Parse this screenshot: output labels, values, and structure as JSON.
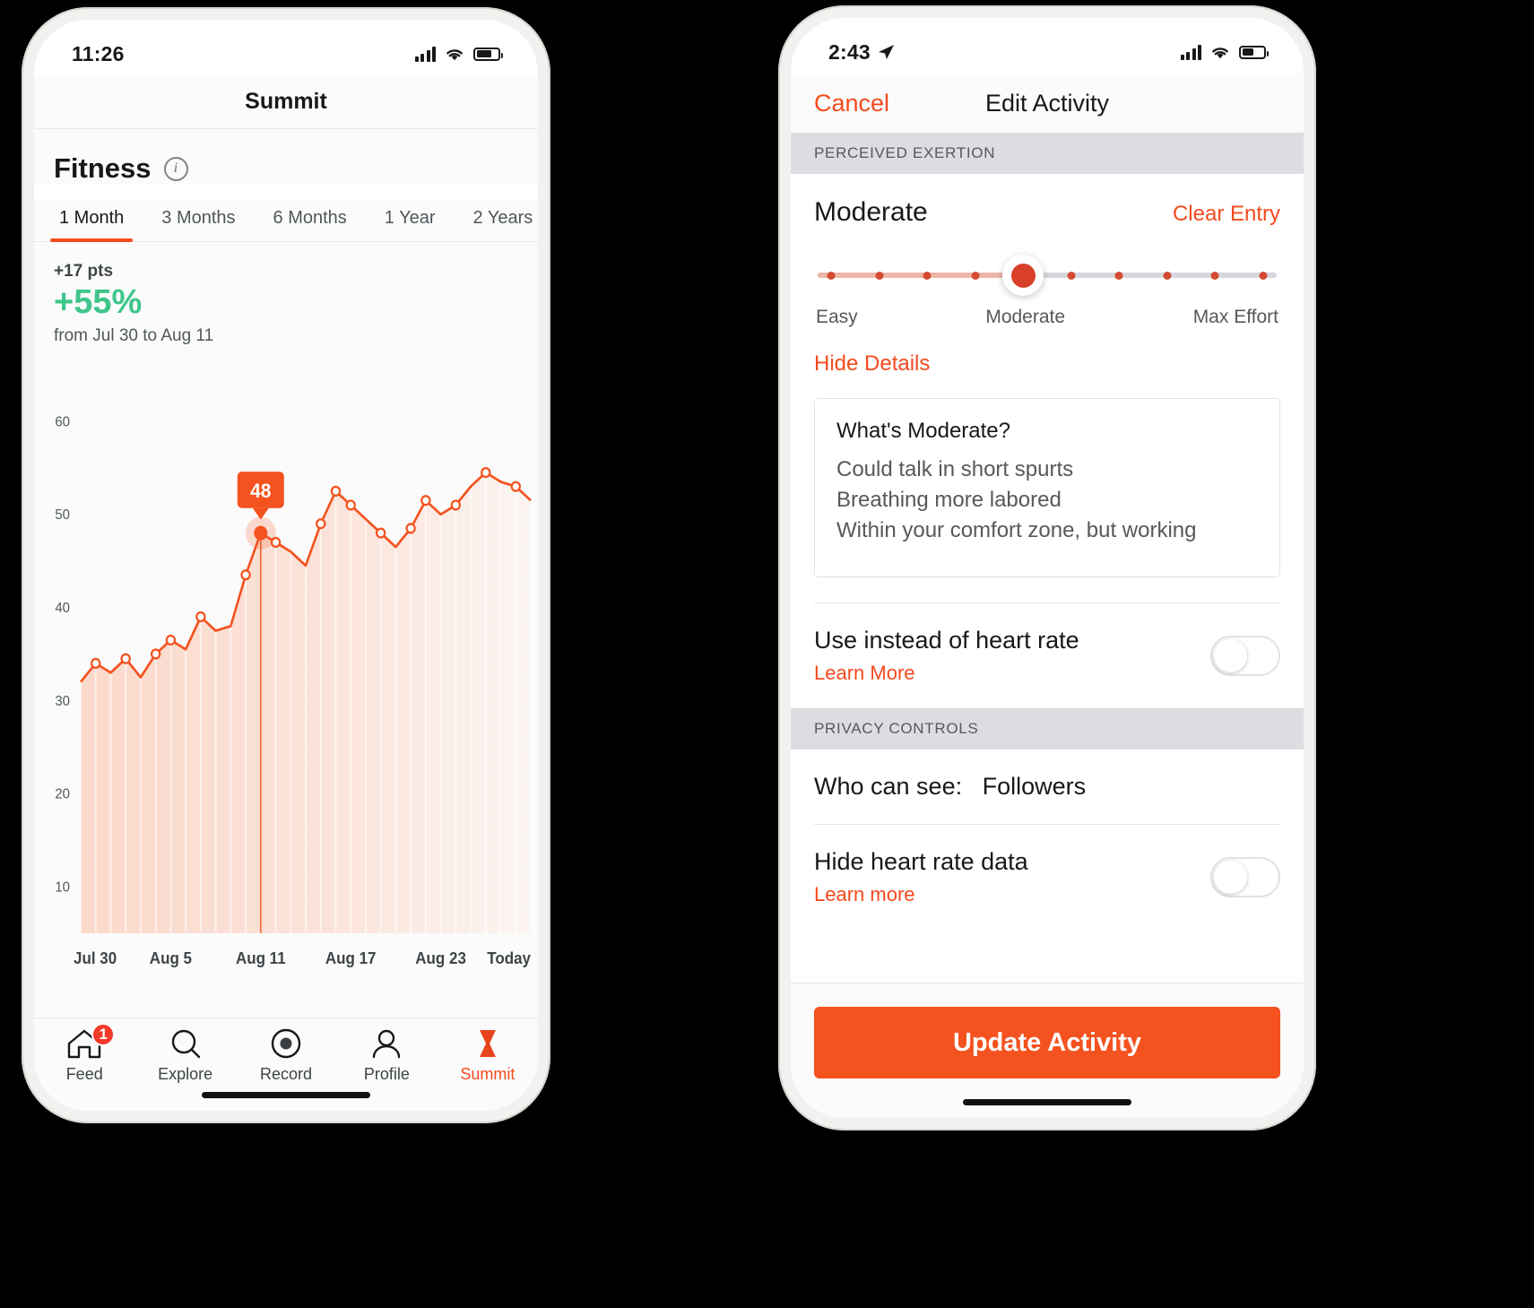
{
  "left_phone": {
    "status_bar": {
      "time": "11:26",
      "signal_icon": "cellular-bars-icon",
      "wifi_icon": "wifi-icon",
      "battery_icon": "battery-icon"
    },
    "nav_title": "Summit",
    "section_title": "Fitness",
    "info_icon": "info-icon",
    "range_tabs": [
      {
        "label": "1 Month",
        "active": true
      },
      {
        "label": "3 Months",
        "active": false
      },
      {
        "label": "6 Months",
        "active": false
      },
      {
        "label": "1 Year",
        "active": false
      },
      {
        "label": "2 Years",
        "active": false
      }
    ],
    "stats": {
      "points": "+17 pts",
      "percent": "+55%",
      "range": "from Jul 30 to Aug 11",
      "percent_color": "#3fc58a"
    },
    "tab_bar": [
      {
        "label": "Feed",
        "icon": "home-icon",
        "badge": "1",
        "active": false
      },
      {
        "label": "Explore",
        "icon": "search-icon",
        "badge": "",
        "active": false
      },
      {
        "label": "Record",
        "icon": "record-icon",
        "badge": "",
        "active": false
      },
      {
        "label": "Profile",
        "icon": "person-icon",
        "badge": "",
        "active": false
      },
      {
        "label": "Summit",
        "icon": "summit-chevron-icon",
        "badge": "",
        "active": true
      }
    ]
  },
  "right_phone": {
    "status_bar": {
      "time": "2:43",
      "location_icon": "location-arrow-icon",
      "signal_icon": "cellular-bars-icon",
      "wifi_icon": "wifi-icon",
      "battery_icon": "battery-icon"
    },
    "cancel_label": "Cancel",
    "title": "Edit Activity",
    "exertion_section_header": "PERCEIVED EXERTION",
    "exertion": {
      "value": "Moderate",
      "clear_label": "Clear Entry",
      "slider": {
        "steps": 10,
        "selected_index": 4,
        "min_label": "Easy",
        "mid_label": "Moderate",
        "max_label": "Max Effort",
        "fill_color": "#eeb6a7",
        "thumb_color": "#d8402a"
      },
      "hide_details_label": "Hide Details",
      "details": {
        "title": "What's Moderate?",
        "lines": [
          "Could talk in short spurts",
          "Breathing more labored",
          "Within your comfort zone, but working"
        ]
      }
    },
    "heart_rate_row": {
      "label": "Use instead of heart rate",
      "link": "Learn More",
      "toggle_on": false
    },
    "privacy_section_header": "PRIVACY CONTROLS",
    "who_can_see": {
      "label": "Who can see:",
      "value": "Followers"
    },
    "hide_hr_row": {
      "label": "Hide heart rate data",
      "link": "Learn more",
      "toggle_on": false
    },
    "update_button": "Update Activity",
    "accent_color": "#f4521f"
  },
  "chart_data": {
    "type": "area",
    "title": "Fitness",
    "xlabel": "",
    "ylabel": "",
    "ylim": [
      5,
      65
    ],
    "yticks": [
      10,
      20,
      30,
      40,
      50,
      60
    ],
    "xtick_labels": [
      "Jul 30",
      "Aug 5",
      "Aug 11",
      "Aug 17",
      "Aug 23",
      "Today"
    ],
    "xtick_positions": [
      0,
      6,
      12,
      18,
      24,
      30
    ],
    "grid": false,
    "legend": false,
    "line_color": "#f4521f",
    "fill_color": "#fbd9cb",
    "selected_index": 12,
    "selected_label": "48",
    "values": [
      32,
      34,
      33,
      34.5,
      32.5,
      35,
      36.5,
      35.5,
      39,
      37.5,
      38,
      43.5,
      48,
      47,
      46,
      44.5,
      49,
      52.5,
      51,
      49.5,
      48,
      46.5,
      48.5,
      51.5,
      50,
      51,
      53,
      54.5,
      53.5,
      53,
      51.5
    ]
  }
}
